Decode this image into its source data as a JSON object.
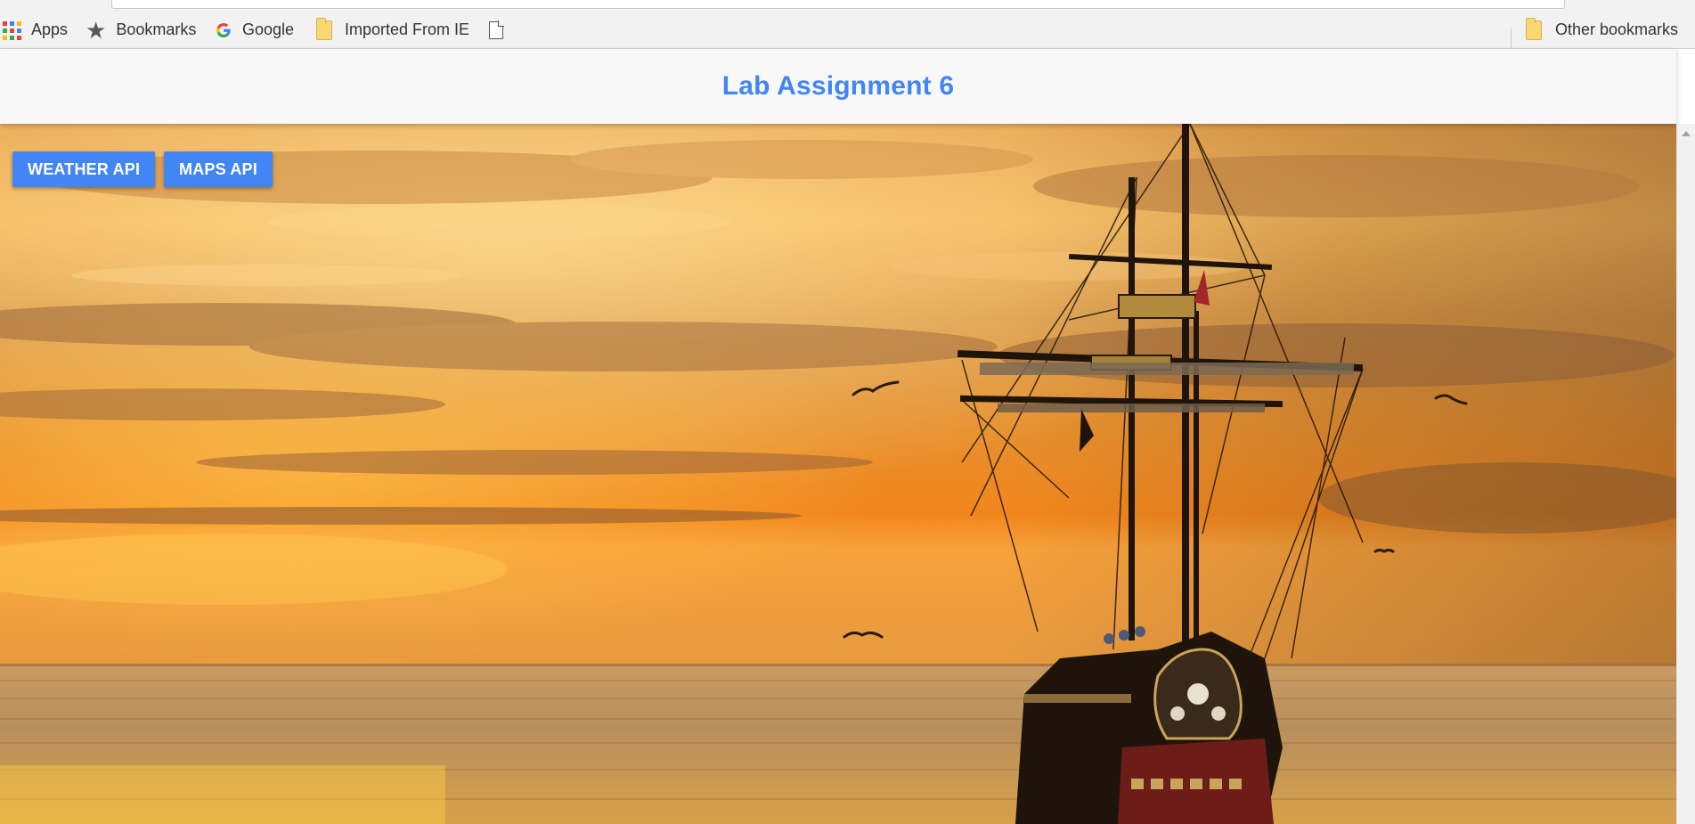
{
  "browser": {
    "bookmarks_bar": {
      "apps": "Apps",
      "bookmarks": "Bookmarks",
      "google": "Google",
      "imported": "Imported From IE",
      "other": "Other bookmarks"
    },
    "icons": {
      "apps": "apps-grid-icon",
      "bookmarks": "star-icon",
      "google": "google-g-icon",
      "imported": "folder-icon",
      "page": "page-icon",
      "other": "folder-icon"
    }
  },
  "page": {
    "title": "Lab Assignment 6",
    "buttons": {
      "weather": "WEATHER API",
      "maps": "MAPS API"
    },
    "background_image": "sunset sailing ship over sea"
  },
  "colors": {
    "accent": "#4285f4",
    "button_text": "#ffffff",
    "header_bg": "#f8f8f8",
    "chrome_bg": "#f2f2f2"
  }
}
